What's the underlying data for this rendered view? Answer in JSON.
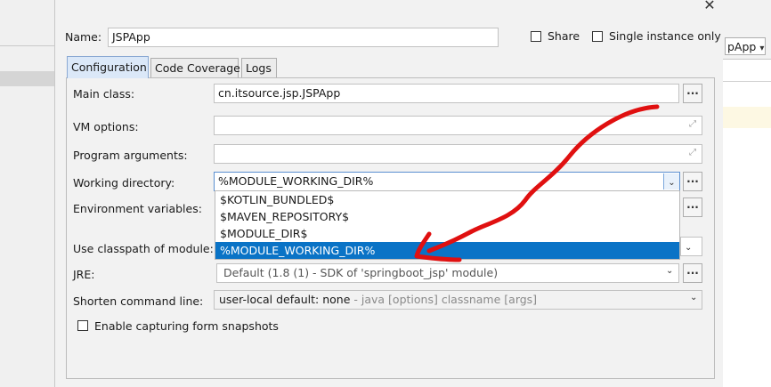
{
  "header": {
    "name_label": "Name:",
    "name_value": "JSPApp",
    "share_label": "Share",
    "single_instance_label": "Single instance only"
  },
  "background": {
    "right_combo_value": "pApp"
  },
  "tabs": [
    {
      "label": "Configuration",
      "active": true
    },
    {
      "label": "Code Coverage",
      "active": false
    },
    {
      "label": "Logs",
      "active": false
    }
  ],
  "form": {
    "main_class_label": "Main class:",
    "main_class_value": "cn.itsource.jsp.JSPApp",
    "vm_options_label": "VM options:",
    "vm_options_value": "",
    "program_arguments_label": "Program arguments:",
    "program_arguments_value": "",
    "working_directory_label": "Working directory:",
    "working_directory_value": "%MODULE_WORKING_DIR%",
    "environment_variables_label": "Environment variables:",
    "classpath_module_label": "Use classpath of module:",
    "jre_label": "JRE:",
    "jre_value": "Default (1.8 (1) - SDK of 'springboot_jsp' module)",
    "shorten_label": "Shorten command line:",
    "shorten_value": "user-local default: none",
    "shorten_hint": " - java [options] classname [args]",
    "snapshots_label": "Enable capturing form snapshots",
    "dots_label": "..."
  },
  "dropdown": {
    "options": [
      "$KOTLIN_BUNDLED$",
      "$MAVEN_REPOSITORY$",
      "$MODULE_DIR$",
      "%MODULE_WORKING_DIR%"
    ],
    "selected_index": 3
  },
  "colors": {
    "selection": "#0a73c6",
    "annotation_arrow": "#e01010",
    "active_tab": "#dbe8f8"
  }
}
